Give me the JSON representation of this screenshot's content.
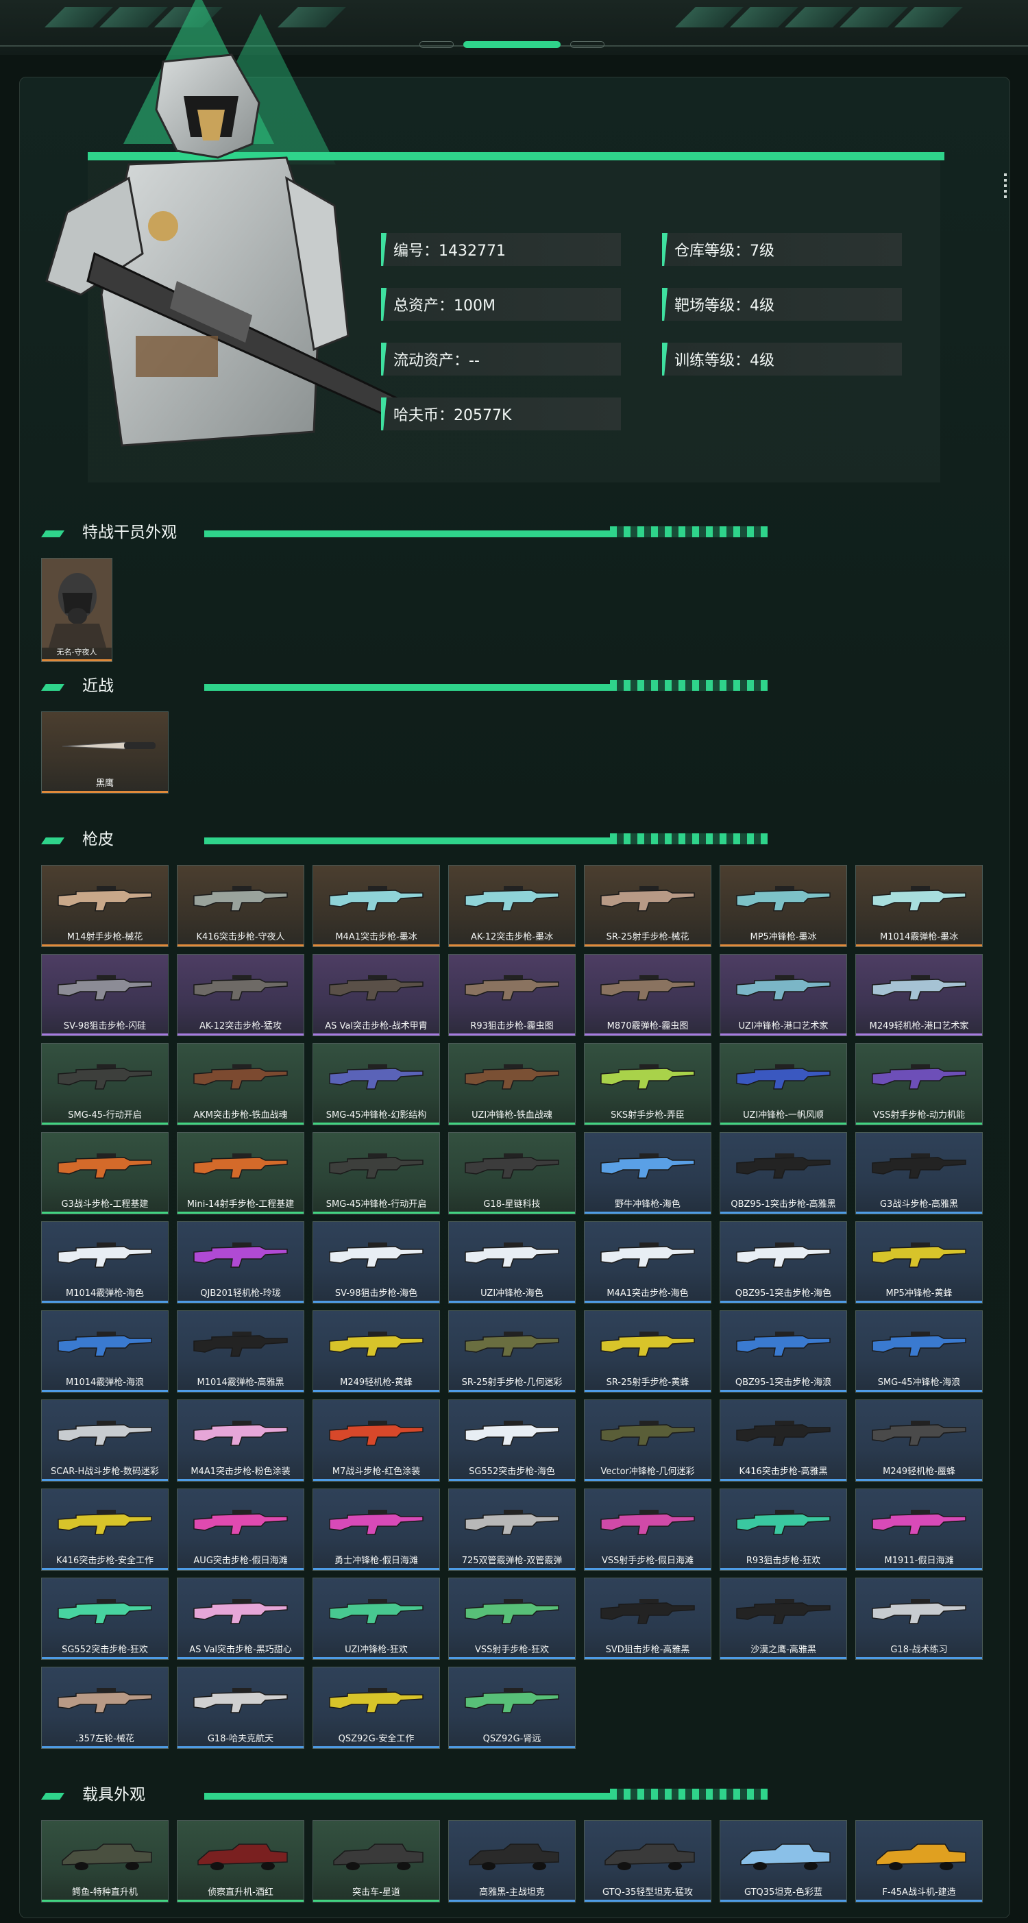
{
  "stats": {
    "id": "编号：1432771",
    "total_assets": "总资产：100M",
    "liquid_assets": "流动资产：--",
    "haf_coin": "哈夫币：20577K",
    "warehouse_level": "仓库等级：7级",
    "range_level": "靶场等级：4级",
    "training_level": "训练等级：4级"
  },
  "sections": {
    "operator": "特战干员外观",
    "melee": "近战",
    "skins": "枪皮",
    "vehicles": "载具外观"
  },
  "operator_card": {
    "label": "无名-守夜人",
    "rarity": "orange"
  },
  "melee_card": {
    "label": "黑鹰",
    "rarity": "orange"
  },
  "skins": [
    {
      "label": "M14射手步枪-械花",
      "rarity": "orange",
      "color": "#c9a88a"
    },
    {
      "label": "K416突击步枪-守夜人",
      "rarity": "orange",
      "color": "#9aa39c"
    },
    {
      "label": "M4A1突击步枪-墨冰",
      "rarity": "orange",
      "color": "#8fd3d8"
    },
    {
      "label": "AK-12突击步枪-墨冰",
      "rarity": "orange",
      "color": "#8fd3d8"
    },
    {
      "label": "SR-25射手步枪-械花",
      "rarity": "orange",
      "color": "#b89a86"
    },
    {
      "label": "MP5冲锋枪-墨冰",
      "rarity": "orange",
      "color": "#7dc2c8"
    },
    {
      "label": "M1014霰弹枪-墨冰",
      "rarity": "orange",
      "color": "#a8dede"
    },
    {
      "label": "SV-98狙击步枪-闪硅",
      "rarity": "purple",
      "color": "#8c8c96"
    },
    {
      "label": "AK-12突击步枪-猛攻",
      "rarity": "purple",
      "color": "#6e6a66"
    },
    {
      "label": "AS Val突击步枪-战术甲胄",
      "rarity": "purple",
      "color": "#5a5048"
    },
    {
      "label": "R93狙击步枪-霾虫图",
      "rarity": "purple",
      "color": "#8a7360"
    },
    {
      "label": "M870霰弹枪-霾虫图",
      "rarity": "purple",
      "color": "#8a7360"
    },
    {
      "label": "UZI冲锋枪-港口艺术家",
      "rarity": "purple",
      "color": "#7bb6c7"
    },
    {
      "label": "M249轻机枪-港口艺术家",
      "rarity": "purple",
      "color": "#a6c3d4"
    },
    {
      "label": "SMG-45-行动开启",
      "rarity": "green",
      "color": "#3d3f3c"
    },
    {
      "label": "AKM突击步枪-铁血战魂",
      "rarity": "green",
      "color": "#7c4a30"
    },
    {
      "label": "SMG-45冲锋枪-幻影结构",
      "rarity": "green",
      "color": "#5a63b8"
    },
    {
      "label": "UZI冲锋枪-铁血战魂",
      "rarity": "green",
      "color": "#7a5034"
    },
    {
      "label": "SKS射手步枪-弄臣",
      "rarity": "green",
      "color": "#a9d24a"
    },
    {
      "label": "UZI冲锋枪-一帆风顺",
      "rarity": "green",
      "color": "#3a58c0"
    },
    {
      "label": "VSS射手步枪-动力机能",
      "rarity": "green",
      "color": "#6d4fb8"
    },
    {
      "label": "G3战斗步枪-工程基建",
      "rarity": "green",
      "color": "#d46a2a"
    },
    {
      "label": "Mini-14射手步枪-工程基建",
      "rarity": "green",
      "color": "#d46a2a"
    },
    {
      "label": "SMG-45冲锋枪-行动开启",
      "rarity": "green",
      "color": "#3d3f3c"
    },
    {
      "label": "G18-星链科技",
      "rarity": "green",
      "color": "#3c3c3c"
    },
    {
      "label": "野牛冲锋枪-海色",
      "rarity": "blue",
      "color": "#5aa0e6"
    },
    {
      "label": "QBZ95-1突击步枪-高雅黑",
      "rarity": "blue",
      "color": "#232323"
    },
    {
      "label": "G3战斗步枪-高雅黑",
      "rarity": "blue",
      "color": "#232323"
    },
    {
      "label": "M1014霰弹枪-海色",
      "rarity": "blue",
      "color": "#e8eef4"
    },
    {
      "label": "QJB201轻机枪-玲珑",
      "rarity": "blue",
      "color": "#b04ad4"
    },
    {
      "label": "SV-98狙击步枪-海色",
      "rarity": "blue",
      "color": "#e8eef4"
    },
    {
      "label": "UZI冲锋枪-海色",
      "rarity": "blue",
      "color": "#e8eef4"
    },
    {
      "label": "M4A1突击步枪-海色",
      "rarity": "blue",
      "color": "#e8eef4"
    },
    {
      "label": "QBZ95-1突击步枪-海色",
      "rarity": "blue",
      "color": "#e8eef4"
    },
    {
      "label": "MP5冲锋枪-黄蜂",
      "rarity": "blue",
      "color": "#d8c42a"
    },
    {
      "label": "M1014霰弹枪-海浪",
      "rarity": "blue",
      "color": "#3a7ad0"
    },
    {
      "label": "M1014霰弹枪-高雅黑",
      "rarity": "blue",
      "color": "#232323"
    },
    {
      "label": "M249轻机枪-黄蜂",
      "rarity": "blue",
      "color": "#d8c42a"
    },
    {
      "label": "SR-25射手步枪-几何迷彩",
      "rarity": "blue",
      "color": "#6a6e40"
    },
    {
      "label": "SR-25射手步枪-黄蜂",
      "rarity": "blue",
      "color": "#d8c42a"
    },
    {
      "label": "QBZ95-1突击步枪-海浪",
      "rarity": "blue",
      "color": "#3a7ad0"
    },
    {
      "label": "SMG-45冲锋枪-海浪",
      "rarity": "blue",
      "color": "#3a7ad0"
    },
    {
      "label": "SCAR-H战斗步枪-数码迷彩",
      "rarity": "blue",
      "color": "#c8ccd0"
    },
    {
      "label": "M4A1突击步枪-粉色涂装",
      "rarity": "blue",
      "color": "#e6a6d8"
    },
    {
      "label": "M7战斗步枪-红色涂装",
      "rarity": "blue",
      "color": "#d8482a"
    },
    {
      "label": "SG552突击步枪-海色",
      "rarity": "blue",
      "color": "#e8eef4"
    },
    {
      "label": "Vector冲锋枪-几何迷彩",
      "rarity": "blue",
      "color": "#5a5e38"
    },
    {
      "label": "K416突击步枪-高雅黑",
      "rarity": "blue",
      "color": "#232323"
    },
    {
      "label": "M249轻机枪-蜃蜂",
      "rarity": "blue",
      "color": "#4a4a4a"
    },
    {
      "label": "K416突击步枪-安全工作",
      "rarity": "blue",
      "color": "#d8c42a"
    },
    {
      "label": "AUG突击步枪-假日海滩",
      "rarity": "blue",
      "color": "#e04ab0"
    },
    {
      "label": "勇士冲锋枪-假日海滩",
      "rarity": "blue",
      "color": "#d84ab8"
    },
    {
      "label": "725双管霰弹枪-双管霰弹",
      "rarity": "blue",
      "color": "#b8b8b8"
    },
    {
      "label": "VSS射手步枪-假日海滩",
      "rarity": "blue",
      "color": "#d04aa8"
    },
    {
      "label": "R93狙击步枪-狂欢",
      "rarity": "blue",
      "color": "#3ac8a0"
    },
    {
      "label": "M1911-假日海滩",
      "rarity": "blue",
      "color": "#d84ab8"
    },
    {
      "label": "SG552突击步枪-狂欢",
      "rarity": "blue",
      "color": "#48d4a0"
    },
    {
      "label": "AS Val突击步枪-黑巧甜心",
      "rarity": "blue",
      "color": "#e6a6d8"
    },
    {
      "label": "UZI冲锋枪-狂欢",
      "rarity": "blue",
      "color": "#48c890"
    },
    {
      "label": "VSS射手步枪-狂欢",
      "rarity": "blue",
      "color": "#58c078"
    },
    {
      "label": "SVD狙击步枪-高雅黑",
      "rarity": "blue",
      "color": "#232323"
    },
    {
      "label": "沙漠之鹰-高雅黑",
      "rarity": "blue",
      "color": "#232323"
    },
    {
      "label": "G18-战术练习",
      "rarity": "blue",
      "color": "#c8ccd0"
    },
    {
      "label": ".357左轮-械花",
      "rarity": "blue",
      "color": "#b89a86"
    },
    {
      "label": "G18-哈夫克航天",
      "rarity": "blue",
      "color": "#d0d0d0"
    },
    {
      "label": "QSZ92G-安全工作",
      "rarity": "blue",
      "color": "#d8c42a"
    },
    {
      "label": "QSZ92G-肾远",
      "rarity": "blue",
      "color": "#58c078"
    }
  ],
  "vehicles": [
    {
      "label": "鳄鱼-特种直升机",
      "rarity": "green",
      "color": "#4a5040"
    },
    {
      "label": "侦察直升机-酒红",
      "rarity": "green",
      "color": "#7a2020"
    },
    {
      "label": "突击车-星道",
      "rarity": "green",
      "color": "#3a3a3a"
    },
    {
      "label": "高雅黑-主战坦克",
      "rarity": "blue",
      "color": "#2a2a2a"
    },
    {
      "label": "GTQ-35轻型坦克-猛攻",
      "rarity": "blue",
      "color": "#3a3a3a"
    },
    {
      "label": "GTQ35坦克-色彩蓝",
      "rarity": "blue",
      "color": "#8ac0e8"
    },
    {
      "label": "F-45A战斗机-建造",
      "rarity": "blue",
      "color": "#e0a020"
    }
  ]
}
